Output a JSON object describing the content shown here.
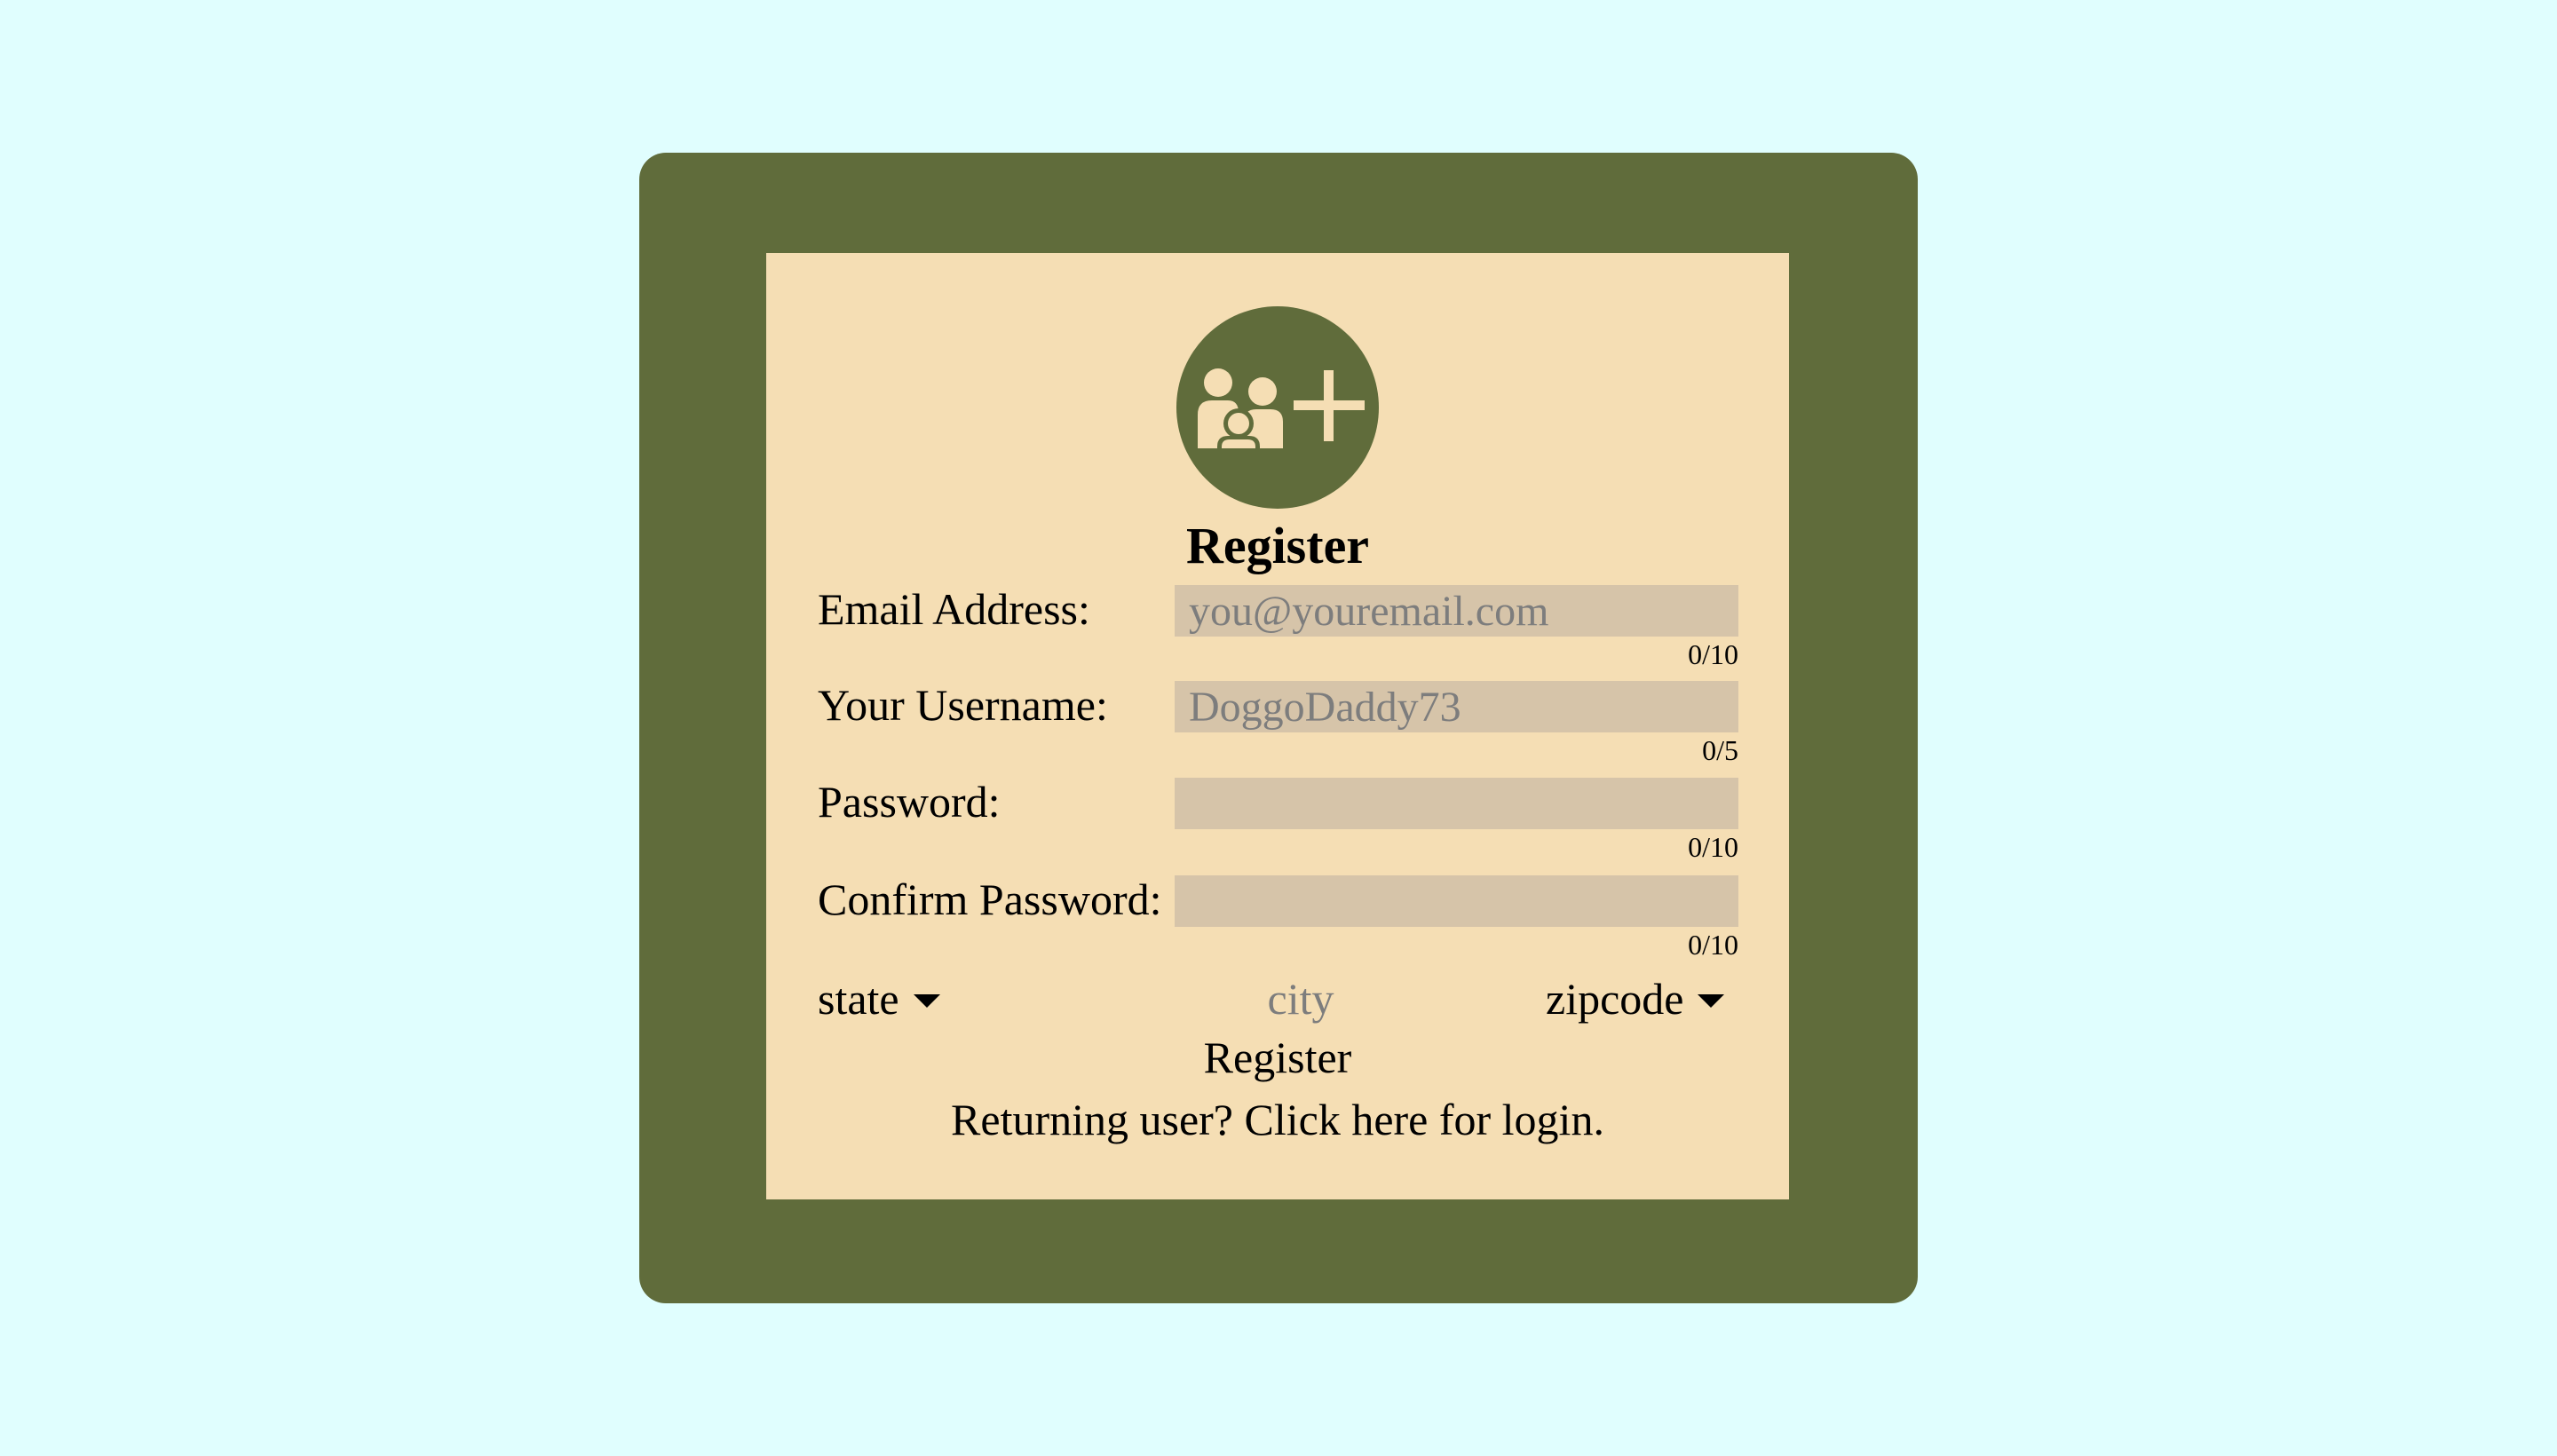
{
  "colors": {
    "page_background": "#e0fefe",
    "frame": "#606c3b",
    "panel": "#f5deb4",
    "input_background": "#d6c4a9",
    "placeholder_text": "#7d7d7d"
  },
  "header": {
    "icon": "add-family-icon",
    "title": "Register"
  },
  "form": {
    "email": {
      "label": "Email Address:",
      "placeholder": "you@youremail.com",
      "value": "",
      "counter": "0/10"
    },
    "username": {
      "label": "Your Username:",
      "placeholder": "DoggoDaddy73",
      "value": "",
      "counter": "0/5"
    },
    "password": {
      "label": "Password:",
      "placeholder": "",
      "value": "",
      "counter": "0/10"
    },
    "confirm_password": {
      "label": "Confirm Password:",
      "placeholder": "",
      "value": "",
      "counter": "0/10"
    },
    "state": {
      "label": "state",
      "icon": "caret-down-icon"
    },
    "city": {
      "placeholder": "city"
    },
    "zipcode": {
      "label": "zipcode",
      "icon": "caret-down-icon"
    },
    "submit_label": "Register",
    "login_link": "Returning user? Click here for login."
  }
}
